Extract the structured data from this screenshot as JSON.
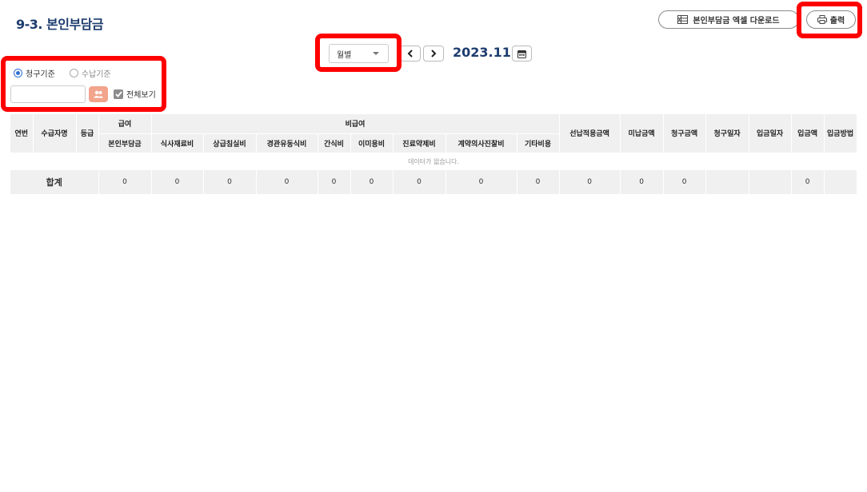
{
  "page": {
    "title": "9-3. 본인부담금"
  },
  "toolbar": {
    "excel_label": "본인부담금 엑셀 다운로드",
    "excel_icon": "excel-icon",
    "print_label": "출력",
    "print_icon": "printer-icon"
  },
  "period": {
    "select_value": "월별",
    "current": "2023.11",
    "prev_icon": "chevron-left-icon",
    "next_icon": "chevron-right-icon",
    "calendar_icon": "calendar-icon"
  },
  "filter": {
    "radio_options": [
      {
        "label": "청구기준",
        "selected": true
      },
      {
        "label": "수납기준",
        "selected": false
      }
    ],
    "search_value": "",
    "search_placeholder": "",
    "people_icon": "people-icon",
    "view_all_label": "전체보기",
    "view_all_checked": true
  },
  "table": {
    "headers": {
      "no": "연번",
      "name": "수급자명",
      "grade": "등급",
      "benefit_group": "급여",
      "nonbenefit_group": "비급여",
      "copay": "본인부담금",
      "nonbenefit_cols": [
        "식사재료비",
        "상급침실비",
        "경관유동식비",
        "간식비",
        "이미용비",
        "진료약제비",
        "계약의사진찰비",
        "기타비용"
      ],
      "advance_applied": "선납적용금액",
      "unpaid": "미납금액",
      "billed_amount": "청구금액",
      "billed_date": "청구일자",
      "deposit_date": "입금일자",
      "deposit_amount": "입금액",
      "deposit_method": "입금방법"
    },
    "empty_message": "데이터가 없습니다.",
    "total": {
      "label": "합계",
      "copay": "0",
      "nonbenefit": [
        "0",
        "0",
        "0",
        "0",
        "0",
        "0",
        "0",
        "0"
      ],
      "advance_applied": "0",
      "unpaid": "0",
      "billed_amount": "0",
      "billed_date": "",
      "deposit_date": "",
      "deposit_amount": "0",
      "deposit_method": ""
    }
  },
  "colors": {
    "title": "#1d3c6e",
    "highlight": "#ff0000",
    "header_bg": "#f0f0f0",
    "people_button": "#f2a48c",
    "radio_selected": "#2f6fd6"
  }
}
